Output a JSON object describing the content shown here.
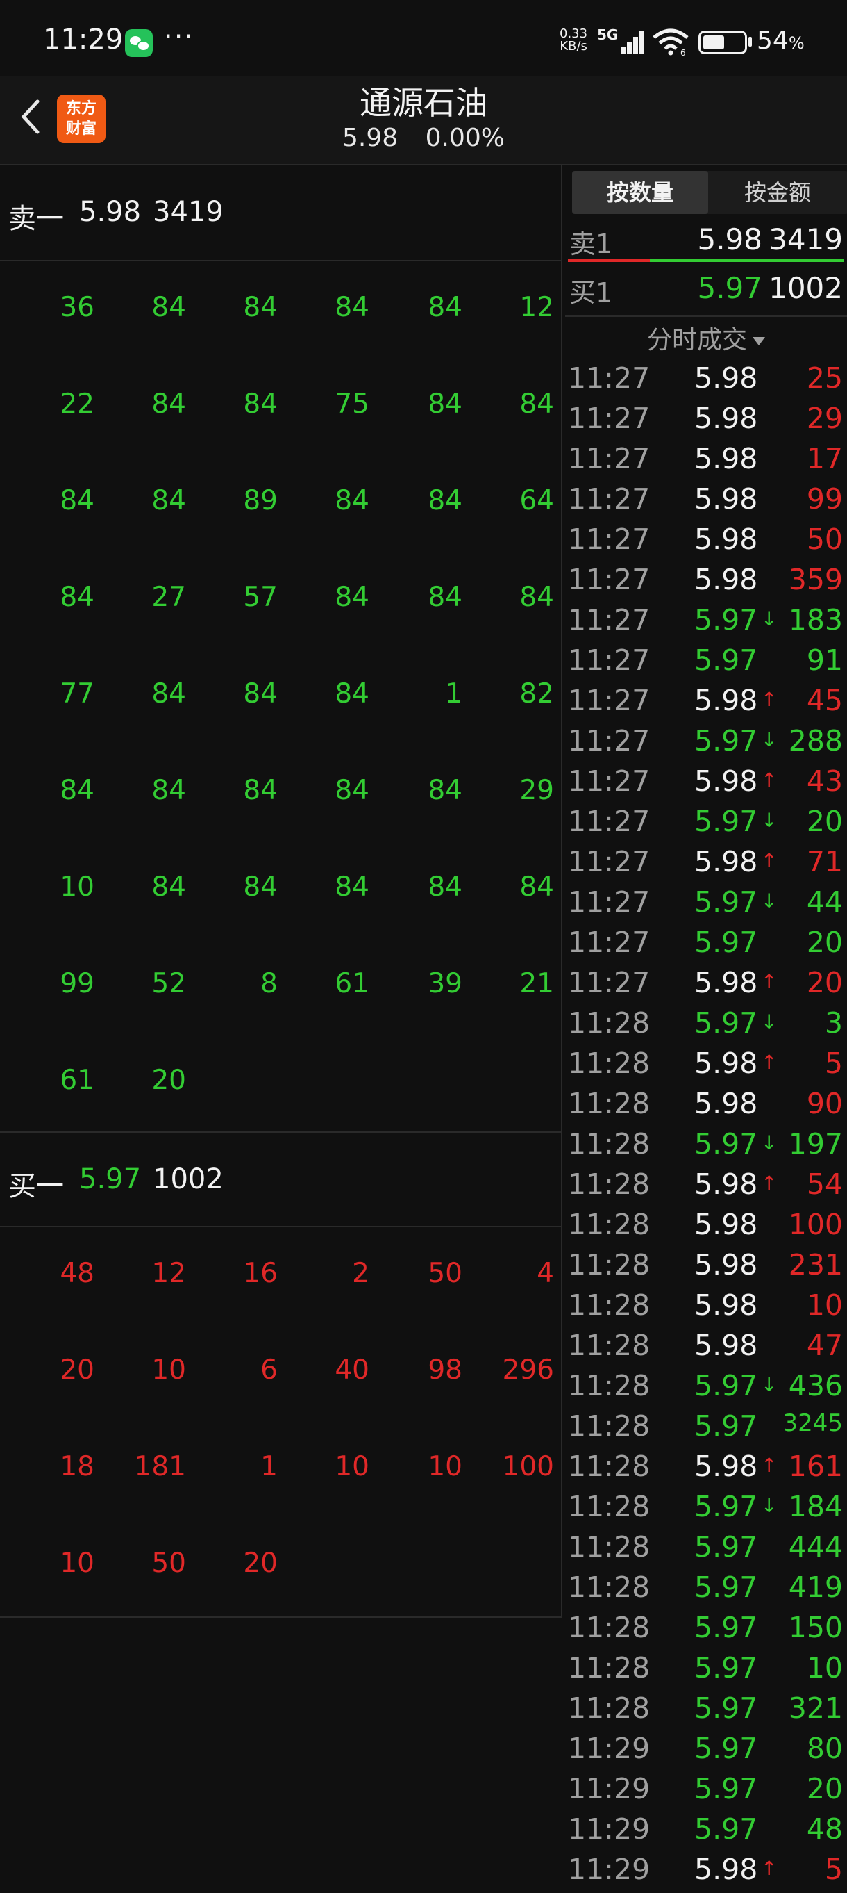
{
  "status_bar": {
    "time": "11:29",
    "more": "···",
    "net_speed_value": "0.33",
    "net_speed_unit": "KB/s",
    "network": "5G",
    "wifi_badge": "6",
    "battery_pct": "54",
    "battery_unit": "%",
    "battery_level": 0.54
  },
  "header": {
    "logo_line1": "东方",
    "logo_line2": "财富",
    "title": "通源石油",
    "price": "5.98",
    "change_pct": "0.00%"
  },
  "orderbook": {
    "sell_label": "卖一",
    "sell_price": "5.98",
    "sell_volume": "3419",
    "sell_orders": [
      [
        "36",
        "84",
        "84",
        "84",
        "84",
        "12"
      ],
      [
        "22",
        "84",
        "84",
        "75",
        "84",
        "84"
      ],
      [
        "84",
        "84",
        "89",
        "84",
        "84",
        "64"
      ],
      [
        "84",
        "27",
        "57",
        "84",
        "84",
        "84"
      ],
      [
        "77",
        "84",
        "84",
        "84",
        "1",
        "82"
      ],
      [
        "84",
        "84",
        "84",
        "84",
        "84",
        "29"
      ],
      [
        "10",
        "84",
        "84",
        "84",
        "84",
        "84"
      ],
      [
        "99",
        "52",
        "8",
        "61",
        "39",
        "21"
      ],
      [
        "61",
        "20"
      ]
    ],
    "buy_label": "买一",
    "buy_price": "5.97",
    "buy_volume": "1002",
    "buy_orders": [
      [
        "48",
        "12",
        "16",
        "2",
        "50",
        "4"
      ],
      [
        "20",
        "10",
        "6",
        "40",
        "98",
        "296"
      ],
      [
        "18",
        "181",
        "1",
        "10",
        "10",
        "100"
      ],
      [
        "10",
        "50",
        "20"
      ]
    ]
  },
  "right_panel": {
    "tab_qty": "按数量",
    "tab_amount": "按金额",
    "ask_label": "卖1",
    "ask_price": "5.98",
    "ask_volume": "3419",
    "bid_label": "买1",
    "bid_price": "5.97",
    "bid_volume": "1002",
    "ticks_title": "分时成交",
    "ticks": [
      {
        "time": "11:27",
        "price": "5.98",
        "dir": "",
        "vol": "25",
        "vol_color": "red"
      },
      {
        "time": "11:27",
        "price": "5.98",
        "dir": "",
        "vol": "29",
        "vol_color": "red"
      },
      {
        "time": "11:27",
        "price": "5.98",
        "dir": "",
        "vol": "17",
        "vol_color": "red"
      },
      {
        "time": "11:27",
        "price": "5.98",
        "dir": "",
        "vol": "99",
        "vol_color": "red"
      },
      {
        "time": "11:27",
        "price": "5.98",
        "dir": "",
        "vol": "50",
        "vol_color": "red"
      },
      {
        "time": "11:27",
        "price": "5.98",
        "dir": "",
        "vol": "359",
        "vol_color": "red"
      },
      {
        "time": "11:27",
        "price": "5.97",
        "dir": "↓",
        "vol": "183",
        "vol_color": "green"
      },
      {
        "time": "11:27",
        "price": "5.97",
        "dir": "",
        "vol": "91",
        "vol_color": "green"
      },
      {
        "time": "11:27",
        "price": "5.98",
        "dir": "↑",
        "vol": "45",
        "vol_color": "red"
      },
      {
        "time": "11:27",
        "price": "5.97",
        "dir": "↓",
        "vol": "288",
        "vol_color": "green"
      },
      {
        "time": "11:27",
        "price": "5.98",
        "dir": "↑",
        "vol": "43",
        "vol_color": "red"
      },
      {
        "time": "11:27",
        "price": "5.97",
        "dir": "↓",
        "vol": "20",
        "vol_color": "green"
      },
      {
        "time": "11:27",
        "price": "5.98",
        "dir": "↑",
        "vol": "71",
        "vol_color": "red"
      },
      {
        "time": "11:27",
        "price": "5.97",
        "dir": "↓",
        "vol": "44",
        "vol_color": "green"
      },
      {
        "time": "11:27",
        "price": "5.97",
        "dir": "",
        "vol": "20",
        "vol_color": "green"
      },
      {
        "time": "11:27",
        "price": "5.98",
        "dir": "↑",
        "vol": "20",
        "vol_color": "red"
      },
      {
        "time": "11:28",
        "price": "5.97",
        "dir": "↓",
        "vol": "3",
        "vol_color": "green"
      },
      {
        "time": "11:28",
        "price": "5.98",
        "dir": "↑",
        "vol": "5",
        "vol_color": "red"
      },
      {
        "time": "11:28",
        "price": "5.98",
        "dir": "",
        "vol": "90",
        "vol_color": "red"
      },
      {
        "time": "11:28",
        "price": "5.97",
        "dir": "↓",
        "vol": "197",
        "vol_color": "green"
      },
      {
        "time": "11:28",
        "price": "5.98",
        "dir": "↑",
        "vol": "54",
        "vol_color": "red"
      },
      {
        "time": "11:28",
        "price": "5.98",
        "dir": "",
        "vol": "100",
        "vol_color": "red"
      },
      {
        "time": "11:28",
        "price": "5.98",
        "dir": "",
        "vol": "231",
        "vol_color": "red"
      },
      {
        "time": "11:28",
        "price": "5.98",
        "dir": "",
        "vol": "10",
        "vol_color": "red"
      },
      {
        "time": "11:28",
        "price": "5.98",
        "dir": "",
        "vol": "47",
        "vol_color": "red"
      },
      {
        "time": "11:28",
        "price": "5.97",
        "dir": "↓",
        "vol": "436",
        "vol_color": "green"
      },
      {
        "time": "11:28",
        "price": "5.97",
        "dir": "",
        "vol": "3245",
        "vol_color": "green"
      },
      {
        "time": "11:28",
        "price": "5.98",
        "dir": "↑",
        "vol": "161",
        "vol_color": "red"
      },
      {
        "time": "11:28",
        "price": "5.97",
        "dir": "↓",
        "vol": "184",
        "vol_color": "green"
      },
      {
        "time": "11:28",
        "price": "5.97",
        "dir": "",
        "vol": "444",
        "vol_color": "green"
      },
      {
        "time": "11:28",
        "price": "5.97",
        "dir": "",
        "vol": "419",
        "vol_color": "green"
      },
      {
        "time": "11:28",
        "price": "5.97",
        "dir": "",
        "vol": "150",
        "vol_color": "green"
      },
      {
        "time": "11:28",
        "price": "5.97",
        "dir": "",
        "vol": "10",
        "vol_color": "green"
      },
      {
        "time": "11:28",
        "price": "5.97",
        "dir": "",
        "vol": "321",
        "vol_color": "green"
      },
      {
        "time": "11:29",
        "price": "5.97",
        "dir": "",
        "vol": "80",
        "vol_color": "green"
      },
      {
        "time": "11:29",
        "price": "5.97",
        "dir": "",
        "vol": "20",
        "vol_color": "green"
      },
      {
        "time": "11:29",
        "price": "5.97",
        "dir": "",
        "vol": "48",
        "vol_color": "green"
      },
      {
        "time": "11:29",
        "price": "5.98",
        "dir": "↑",
        "vol": "5",
        "vol_color": "red"
      }
    ]
  },
  "colors": {
    "up": "#e02828",
    "down": "#33cc33",
    "background": "#101010",
    "brand": "#f05a14"
  }
}
